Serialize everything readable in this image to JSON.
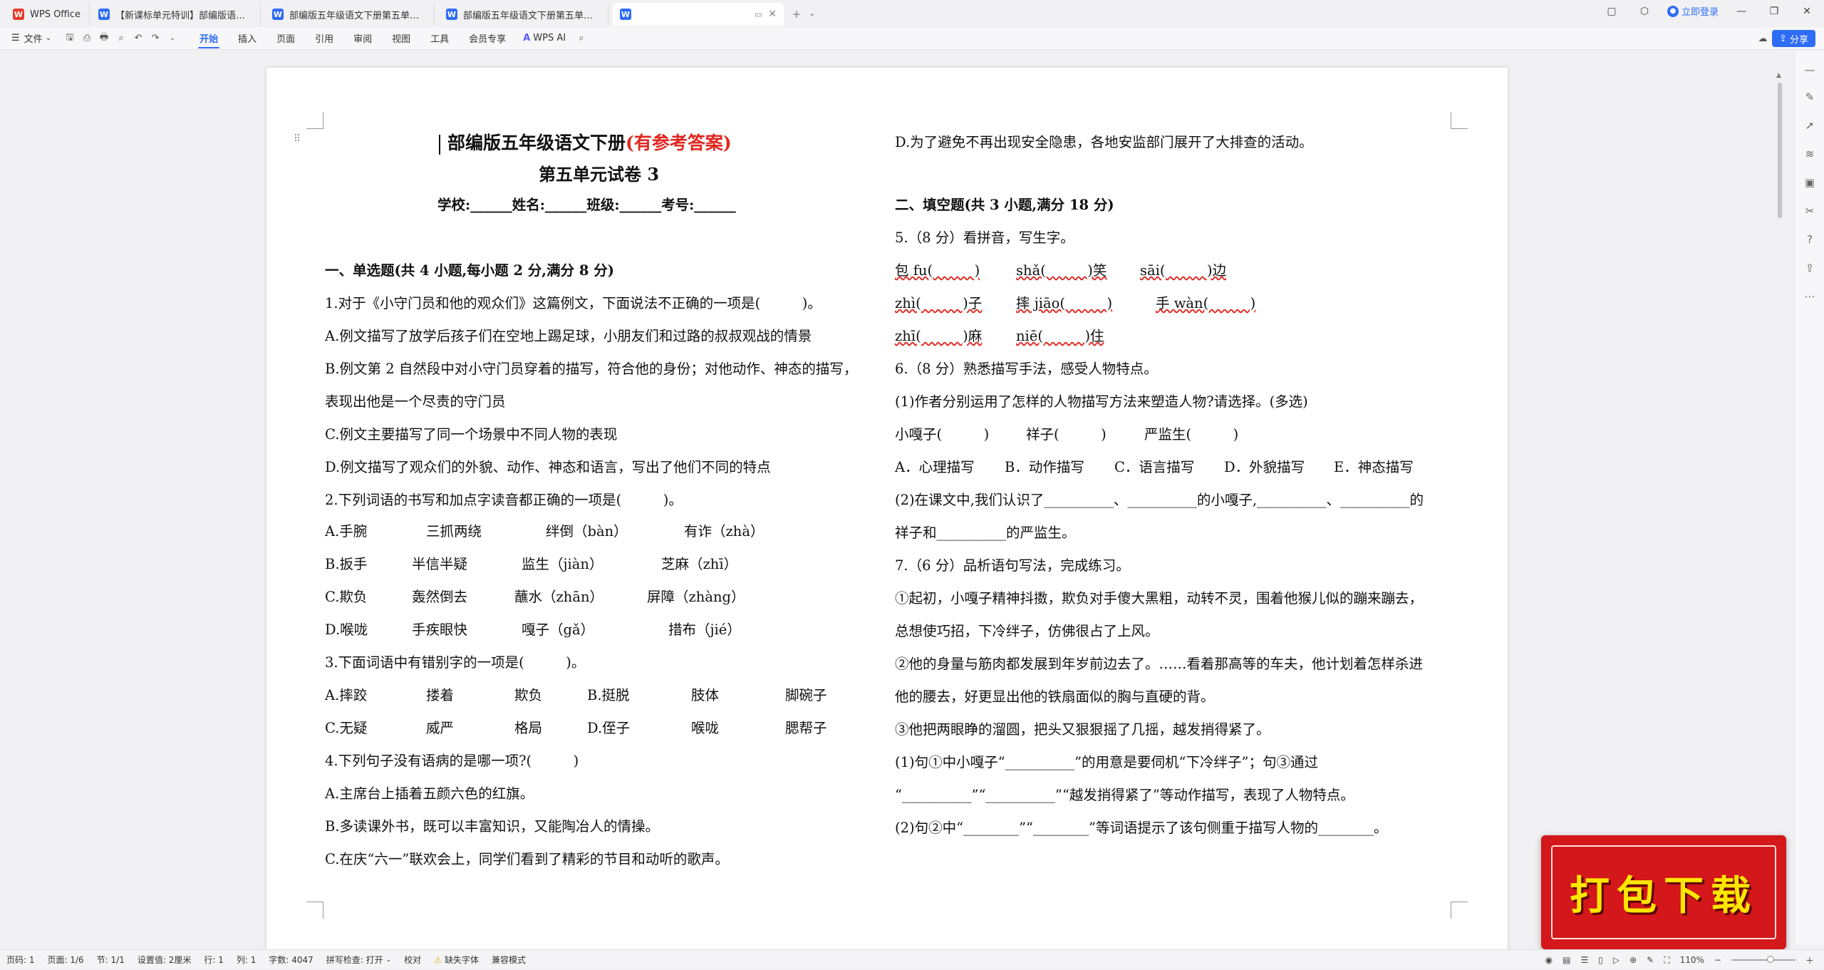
{
  "tabs": [
    {
      "label": "WPS Office",
      "icon": "wps-logo-icon"
    },
    {
      "label": "【新课标单元特训】部编版语文五年",
      "icon": "word-doc-icon"
    },
    {
      "label": "部编版五年级语文下册第五单元试卷",
      "icon": "word-doc-icon"
    },
    {
      "label": "部编版五年级语文下册第五单元试卷",
      "icon": "word-doc-icon"
    },
    {
      "label": "",
      "icon": "word-doc-icon"
    }
  ],
  "titlebar": {
    "login": "立即登录"
  },
  "menu": {
    "file": "文件",
    "items": [
      "开始",
      "插入",
      "页面",
      "引用",
      "审阅",
      "视图",
      "工具",
      "会员专享"
    ],
    "ai": "WPS AI",
    "share": "分享"
  },
  "doc": {
    "title_main": "部编版五年级语文下册",
    "title_red": "(有参考答案)",
    "subtitle": "第五单元试卷 3",
    "info": "学校:______姓名:______班级:______考号:______",
    "s1_head": "一、单选题(共 4 小题,每小题 2 分,满分 8 分)",
    "q1": "1.对于《小守门员和他的观众们》这篇例文，下面说法不正确的一项是(　　　)。",
    "q1a": "A.例文描写了放学后孩子们在空地上踢足球，小朋友们和过路的叔叔观战的情景",
    "q1b": "B.例文第 2 自然段中对小守门员穿着的描写，符合他的身份；对他动作、神态的描写，",
    "q1b2": "表现出他是一个尽责的守门员",
    "q1c": "C.例文主要描写了同一个场景中不同人物的表现",
    "q1d": "D.例文描写了观众们的外貌、动作、神态和语言，写出了他们不同的特点",
    "q2": "2.下列词语的书写和加点字读音都正确的一项是(　　　)。",
    "q2rows": [
      [
        "A.手腕",
        "三抓两绕",
        "绊倒（bàn）",
        "有诈（zhà）"
      ],
      [
        "B.扳手",
        "半信半疑",
        "监生（jiàn）",
        "芝麻（zhī）"
      ],
      [
        "C.欺负",
        "轰然倒去",
        "蘸水（zhān）",
        "屏障（zhàng）"
      ],
      [
        "D.喉咙",
        "手疾眼快",
        "嘎子（gǎ）",
        "措布（jié）"
      ]
    ],
    "q3": "3.下面词语中有错别字的一项是(　　　)。",
    "q3rows": [
      [
        "A.摔跤",
        "搂着",
        "欺负",
        "B.挺脱",
        "肢体",
        "脚碗子"
      ],
      [
        "C.无疑",
        "威严",
        "格局",
        "D.侄子",
        "喉咙",
        "腮帮子"
      ]
    ],
    "q4": "4.下列句子没有语病的是哪一项?(　　　)",
    "q4a": "A.主席台上插着五颜六色的红旗。",
    "q4b": "B.多读课外书，既可以丰富知识，又能陶冶人的情操。",
    "q4c": "C.在庆“六一”联欢会上，同学们看到了精彩的节目和动听的歌声。",
    "q4d": "D.为了避免不再出现安全隐患，各地安监部门展开了大排查的活动。",
    "s2_head": "二、填空题(共 3 小题,满分 18 分)",
    "q5": "5.（8 分）看拼音，写生字。",
    "q5rows": [
      [
        "包 fu(　　　)",
        "shǎ(　　　)笑",
        "sāi(　　　)边"
      ],
      [
        "zhì(　　　)子",
        "摔 jiāo(　　　)",
        "手 wàn(　　　)"
      ],
      [
        "zhī(　　　)麻",
        "niē(　　　)住"
      ]
    ],
    "q6": "6.（8 分）熟悉描写手法，感受人物特点。",
    "q6_1": "(1)作者分别运用了怎样的人物描写方法来塑造人物?请选择。(多选)",
    "q6_people": [
      "小嘎子(　　　)",
      "祥子(　　　)",
      "严监生(　　　)"
    ],
    "q6_opts": [
      "A．心理描写",
      "B．动作描写",
      "C．语言描写",
      "D．外貌描写",
      "E．神态描写"
    ],
    "q6_2": "(2)在课文中,我们认识了__________、__________的小嘎子,__________、__________的",
    "q6_2b": "祥子和__________的严监生。",
    "q7": "7.（6 分）品析语句写法，完成练习。",
    "q7_p1a": "①起初，小嘎子精神抖擞，欺负对手傻大黑粗，动转不灵，围着他猴儿似的蹦来蹦去，",
    "q7_p1b": "总想使巧招，下冷绊子，仿佛很占了上风。",
    "q7_p2a": "②他的身量与筋肉都发展到年岁前边去了。……看着那高等的车夫，他计划着怎样杀进",
    "q7_p2b": "他的腰去，好更显出他的铁扇面似的胸与直硬的背。",
    "q7_p3": "③他把两眼睁的溜圆，把头又狠狠摇了几摇，越发捎得紧了。",
    "q7_1a": "(1)句①中小嘎子“__________”的用意是要伺机“下冷绊子”；句③通过",
    "q7_1b": "“__________”“__________”“越发捎得紧了”等动作描写，表现了人物特点。",
    "q7_2": "(2)句②中“________”“________”等词语提示了该句侧重于描写人物的________。"
  },
  "status": {
    "page_label": "页码: 1",
    "pages": "页面: 1/6",
    "section": "节: 1/1",
    "setting": "设置值: 2厘米",
    "row": "行: 1",
    "col": "列: 1",
    "words": "字数: 4047",
    "spell": "拼写检查: 打开",
    "proof": "校对",
    "missing_font": "缺失字体",
    "compat": "兼容模式",
    "zoom": "110%"
  },
  "promo": {
    "text": "打包下载"
  },
  "colors": {
    "accent": "#2f6cf6",
    "title_red": "#e0271f",
    "promo_bg": "#d3171a",
    "promo_text": "#ffe600"
  }
}
